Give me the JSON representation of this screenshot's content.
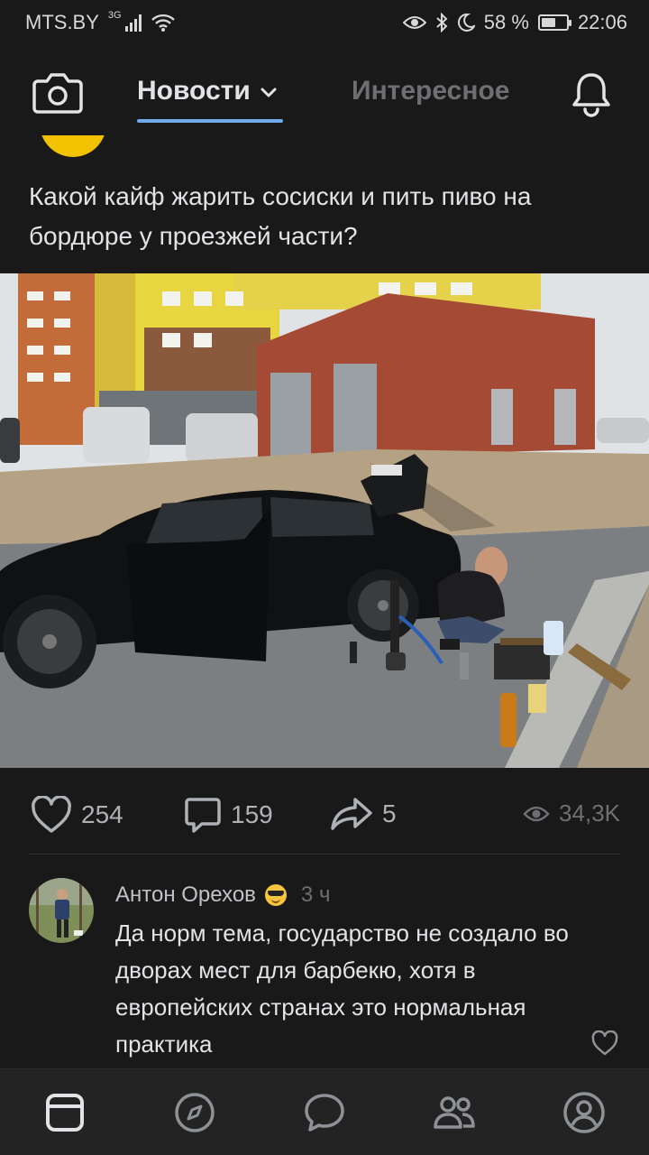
{
  "status_bar": {
    "carrier": "MTS.BY",
    "network": "3G",
    "battery": "58 %",
    "battery_level": 0.58,
    "time": "22:06"
  },
  "header": {
    "tab_news": "Новости",
    "tab_interesting": "Интересное",
    "active_tab": "Новости",
    "accent_color": "#71aaeb"
  },
  "post": {
    "text": "Какой кайф жарить сосиски и пить пиво на бордюре у проезжей части?",
    "likes": "254",
    "comments": "159",
    "shares": "5",
    "views": "34,3K"
  },
  "comment": {
    "author": "Антон Орехов",
    "time": "3 ч",
    "text": "Да норм тема, государство не создало во дворах мест для барбекю, хотя в европейских странах это нормальная практика"
  },
  "icons": {
    "header": [
      "camera-icon",
      "chevron-down-icon",
      "bell-icon"
    ],
    "actions": [
      "heart-icon",
      "comment-icon",
      "share-icon",
      "eye-icon"
    ],
    "nav": [
      "news-icon",
      "discover-icon",
      "messages-icon",
      "friends-icon",
      "profile-icon"
    ]
  }
}
